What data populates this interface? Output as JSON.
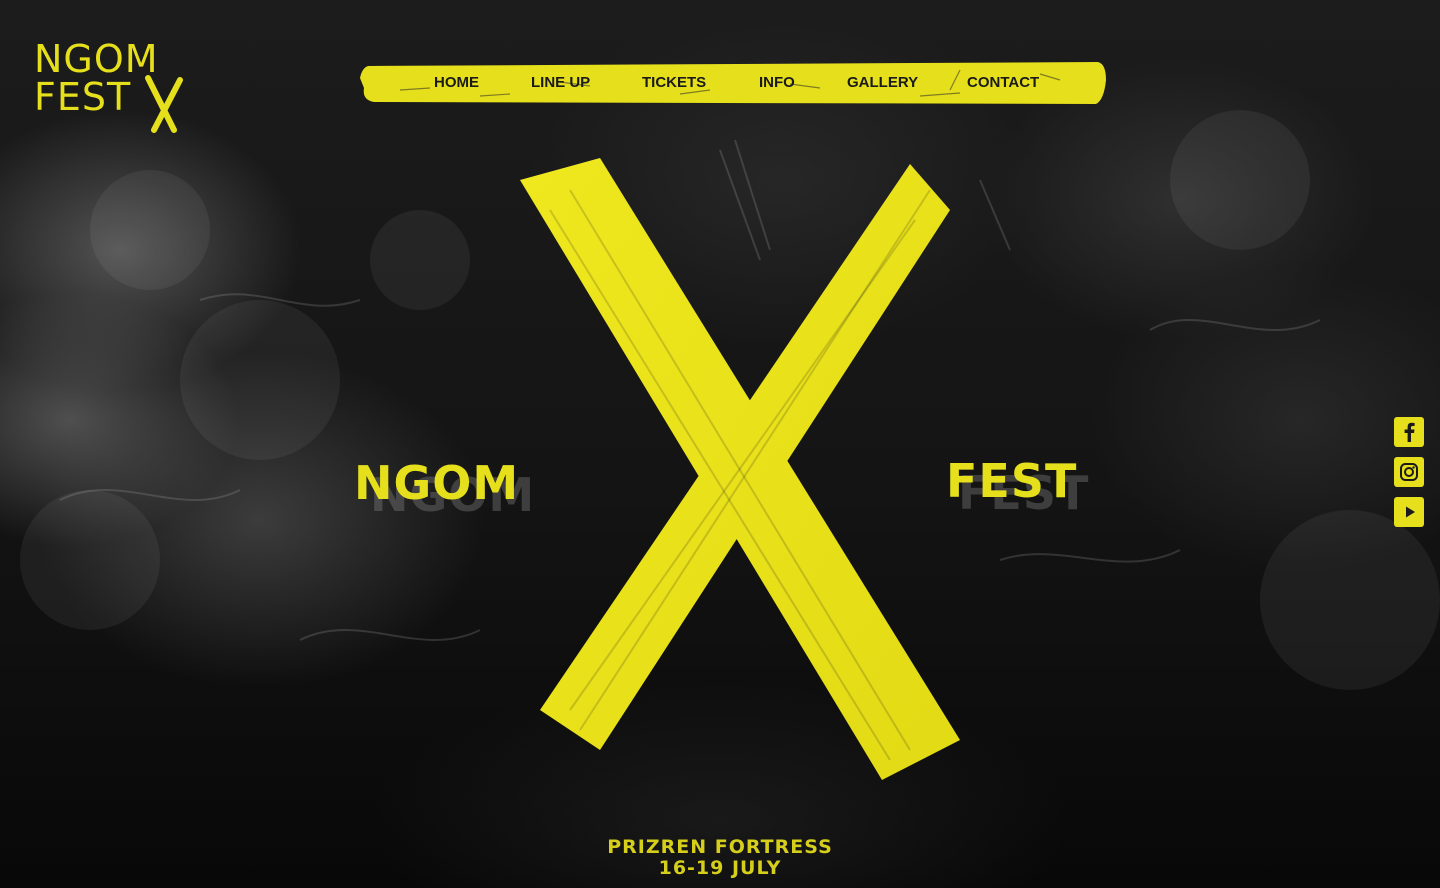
{
  "brand": {
    "logo_line1": "NGOM",
    "logo_line2": "FEST",
    "accent_color": "#e6df1c"
  },
  "nav": {
    "items": [
      {
        "label": "HOME"
      },
      {
        "label": "LINE UP"
      },
      {
        "label": "TICKETS"
      },
      {
        "label": "INFO"
      },
      {
        "label": "GALLERY"
      },
      {
        "label": "CONTACT"
      }
    ]
  },
  "hero": {
    "left_word": "NGOM",
    "right_word": "FEST",
    "venue": "PRIZREN FORTRESS",
    "dates": "16-19 JULY"
  },
  "social": [
    {
      "icon": "facebook-icon"
    },
    {
      "icon": "instagram-icon"
    },
    {
      "icon": "youtube-icon"
    }
  ]
}
